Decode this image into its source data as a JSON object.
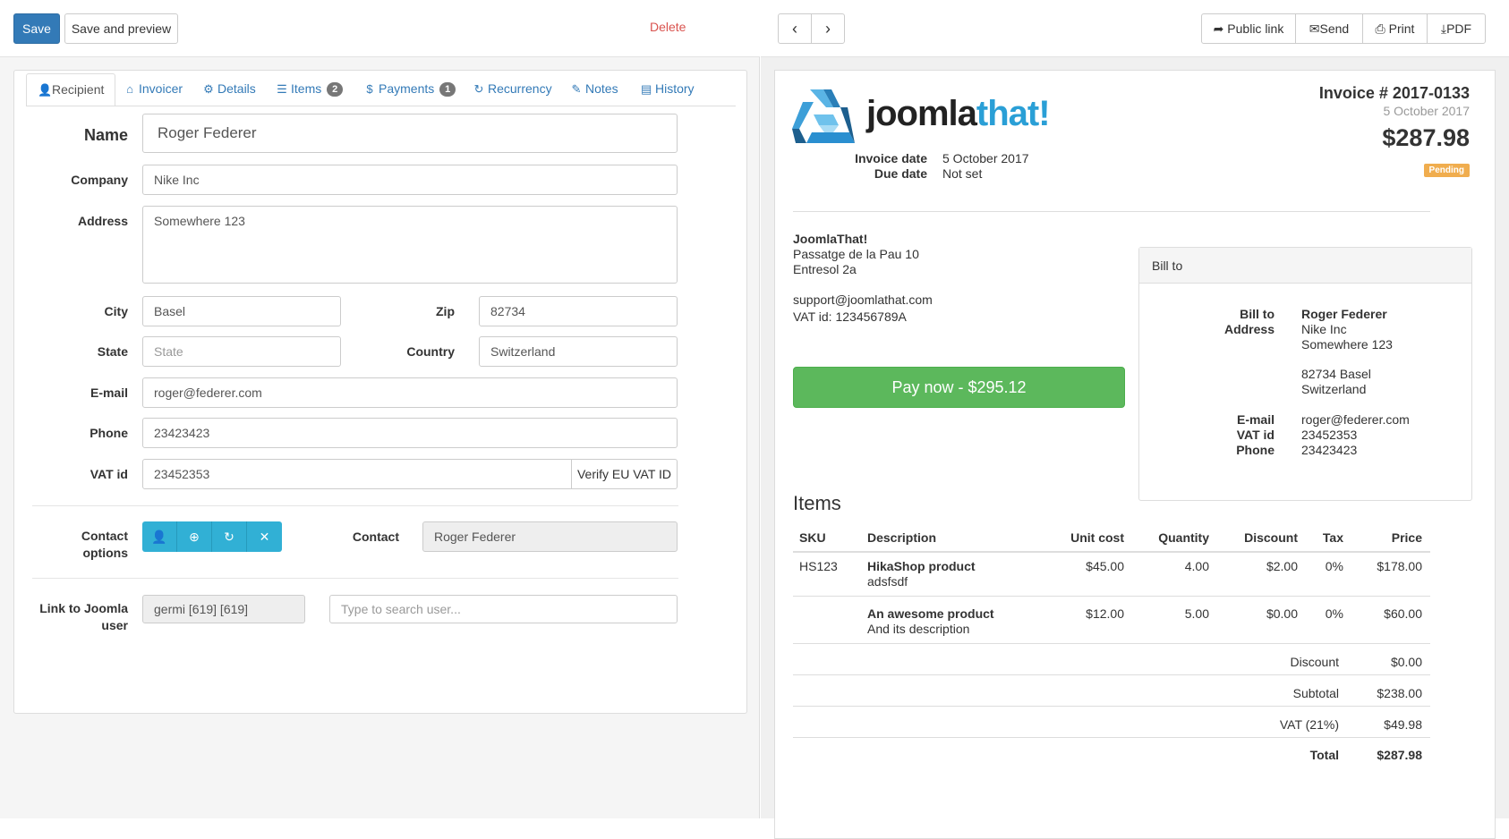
{
  "toolbar": {
    "save": "Save",
    "save_preview": "Save and preview",
    "delete": "Delete"
  },
  "tabs": [
    {
      "label": "Recipient",
      "icon": "user-icon",
      "glyph": "👤"
    },
    {
      "label": "Invoicer",
      "icon": "home-icon",
      "glyph": "⌂"
    },
    {
      "label": "Details",
      "icon": "cog-icon",
      "glyph": "⚙"
    },
    {
      "label": "Items",
      "icon": "list-icon",
      "glyph": "☰",
      "badge": "2"
    },
    {
      "label": "Payments",
      "icon": "dollar-icon",
      "glyph": "$",
      "badge": "1"
    },
    {
      "label": "Recurrency",
      "icon": "refresh-icon",
      "glyph": "↻"
    },
    {
      "label": "Notes",
      "icon": "edit-icon",
      "glyph": "✎"
    },
    {
      "label": "History",
      "icon": "list-alt-icon",
      "glyph": "▤"
    }
  ],
  "form": {
    "name": {
      "label": "Name",
      "value": "Roger Federer"
    },
    "company": {
      "label": "Company",
      "value": "Nike Inc"
    },
    "address": {
      "label": "Address",
      "value": "Somewhere 123"
    },
    "city": {
      "label": "City",
      "value": "Basel"
    },
    "zip": {
      "label": "Zip",
      "value": "82734"
    },
    "state": {
      "label": "State",
      "placeholder": "State"
    },
    "country": {
      "label": "Country",
      "value": "Switzerland"
    },
    "email": {
      "label": "E-mail",
      "value": "roger@federer.com"
    },
    "phone": {
      "label": "Phone",
      "value": "23423423"
    },
    "vat": {
      "label": "VAT id",
      "value": "23452353",
      "button": "Verify EU VAT ID"
    },
    "contact_options": {
      "label_line1": "Contact",
      "label_line2": "options"
    },
    "contact": {
      "label": "Contact",
      "value": "Roger Federer"
    },
    "joomla_user": {
      "label_line1": "Link to Joomla",
      "label_line2": "user",
      "value": "germi [619] [619]",
      "placeholder": "Type to search user..."
    }
  },
  "preview": {
    "nav_prev": "‹",
    "nav_next": "›",
    "actions": {
      "public_link": "Public link",
      "send": "Send",
      "print": "Print",
      "pdf": "PDF"
    },
    "logo_text_a": "joomla",
    "logo_text_b": "that!",
    "invoice_title": "Invoice # 2017-0133",
    "invoice_subdate": "5 October 2017",
    "total_big": "$287.98",
    "status": "Pending",
    "invoice_date_label": "Invoice date",
    "invoice_date": "5 October 2017",
    "due_date_label": "Due date",
    "due_date": "Not set",
    "from": {
      "name": "JoomlaThat!",
      "line1": "Passatge de la Pau 10",
      "line2": "Entresol 2a",
      "email": "support@joomlathat.com",
      "vat": "VAT id: 123456789A"
    },
    "pay_now": "Pay now - $295.12",
    "bill": {
      "heading": "Bill to",
      "billto_label": "Bill to",
      "address_label": "Address",
      "name": "Roger Federer",
      "company": "Nike Inc",
      "street": "Somewhere 123",
      "zipcity": "82734 Basel",
      "country": "Switzerland",
      "email_label": "E-mail",
      "email": "roger@federer.com",
      "vat_label": "VAT id",
      "vat": "23452353",
      "phone_label": "Phone",
      "phone": "23423423"
    },
    "items_heading": "Items",
    "columns": {
      "sku": "SKU",
      "description": "Description",
      "unit_cost": "Unit cost",
      "quantity": "Quantity",
      "discount": "Discount",
      "tax": "Tax",
      "price": "Price"
    },
    "items": [
      {
        "sku": "HS123",
        "name": "HikaShop product",
        "desc": "adsfsdf",
        "unit_cost": "$45.00",
        "quantity": "4.00",
        "discount": "$2.00",
        "tax": "0%",
        "price": "$178.00"
      },
      {
        "sku": "",
        "name": "An awesome product",
        "desc": "And its description",
        "unit_cost": "$12.00",
        "quantity": "5.00",
        "discount": "$0.00",
        "tax": "0%",
        "price": "$60.00"
      }
    ],
    "totals": [
      {
        "label": "Discount",
        "value": "$0.00"
      },
      {
        "label": "Subtotal",
        "value": "$238.00"
      },
      {
        "label": "VAT (21%)",
        "value": "$49.98"
      },
      {
        "label": "Total",
        "value": "$287.98"
      }
    ]
  },
  "colors": {
    "primary": "#337ab7",
    "success": "#5cb85c",
    "info": "#31b0d5",
    "warning": "#f0ad4e",
    "danger": "#d9534f",
    "logo_blue": "#2a9fd6"
  }
}
